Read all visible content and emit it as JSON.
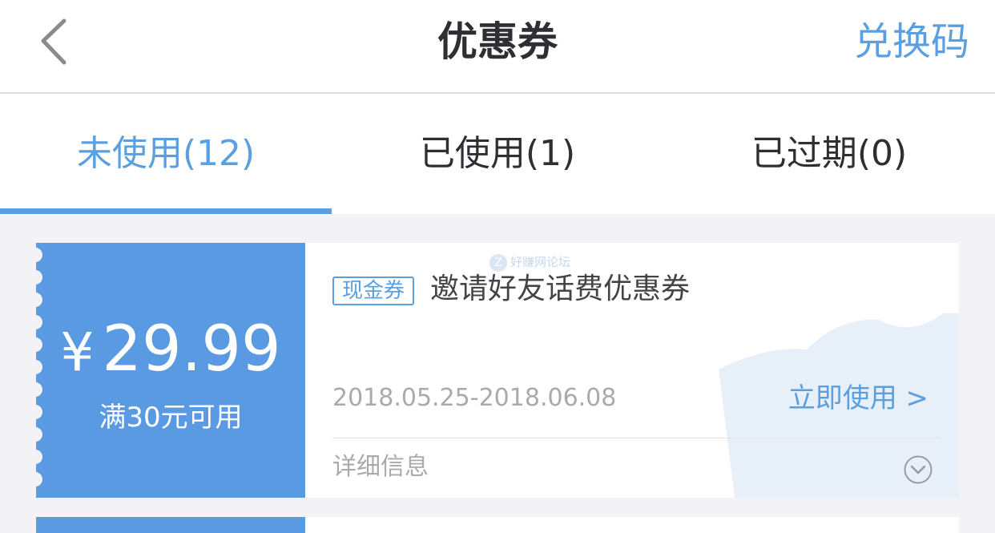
{
  "header": {
    "back_icon": "chevron-left-icon",
    "title": "优惠券",
    "redeem_label": "兑换码"
  },
  "tabs": [
    {
      "label": "未使用(12)",
      "active": true
    },
    {
      "label": "已使用(1)",
      "active": false
    },
    {
      "label": "已过期(0)",
      "active": false
    }
  ],
  "coupons": [
    {
      "currency": "¥",
      "amount": "29.99",
      "condition": "满30元可用",
      "tag": "现金券",
      "name": "邀请好友话费优惠券",
      "date_range": "2018.05.25-2018.06.08",
      "use_label": "立即使用 >",
      "details_label": "详细信息",
      "expand_icon": "chevron-down-circle-icon",
      "watermark": "好赚网论坛"
    }
  ],
  "colors": {
    "accent": "#5a9fe0",
    "coupon_left": "#5a9ae2",
    "background": "#f3f3f5"
  }
}
